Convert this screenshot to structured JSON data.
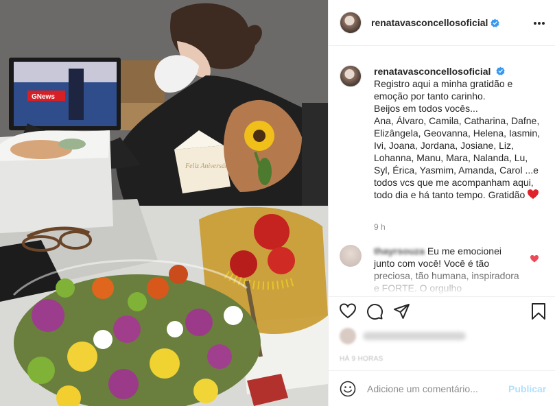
{
  "post": {
    "username": "renatavasconcellosoficial",
    "verified": true,
    "photo": {
      "card_text": "Feliz Aniversário!",
      "tv_logo": "GNews"
    }
  },
  "caption": {
    "username": "renatavasconcellosoficial",
    "text": "Registro aqui a minha gratidão e emoção por tanto carinho.\nBeijos em todos vocês...\nAna, Álvaro, Camila, Catharina, Dafne, Elizângela, Geovanna, Helena, Iasmin, Ivi, Joana, Jordana, Josiane, Liz, Lohanna, Manu, Mara, Nalanda, Lu, Syl, Érica, Yasmim, Amanda, Carol ...e todos vcs que me acompanham aqui, todo dia e há tanto tempo. Gratidão",
    "time": "9 h"
  },
  "comment": {
    "username": "thayrsouza",
    "text": "Eu me emocionei junto com você! Você é tão preciosa, tão humana, inspiradora e FORTE. O orgulho"
  },
  "posted_time": "HÁ 9 HORAS",
  "add_comment": {
    "placeholder": "Adicione um comentário...",
    "publish_label": "Publicar"
  },
  "icons": {
    "more": "more-options-icon",
    "like": "heart-icon",
    "comment": "comment-icon",
    "share": "share-icon",
    "save": "bookmark-icon",
    "emoji": "emoji-icon",
    "verified": "verified-badge-icon"
  },
  "colors": {
    "verified": "#3897f0",
    "heart": "#ed4956",
    "publish_disabled": "#b2dffc"
  }
}
